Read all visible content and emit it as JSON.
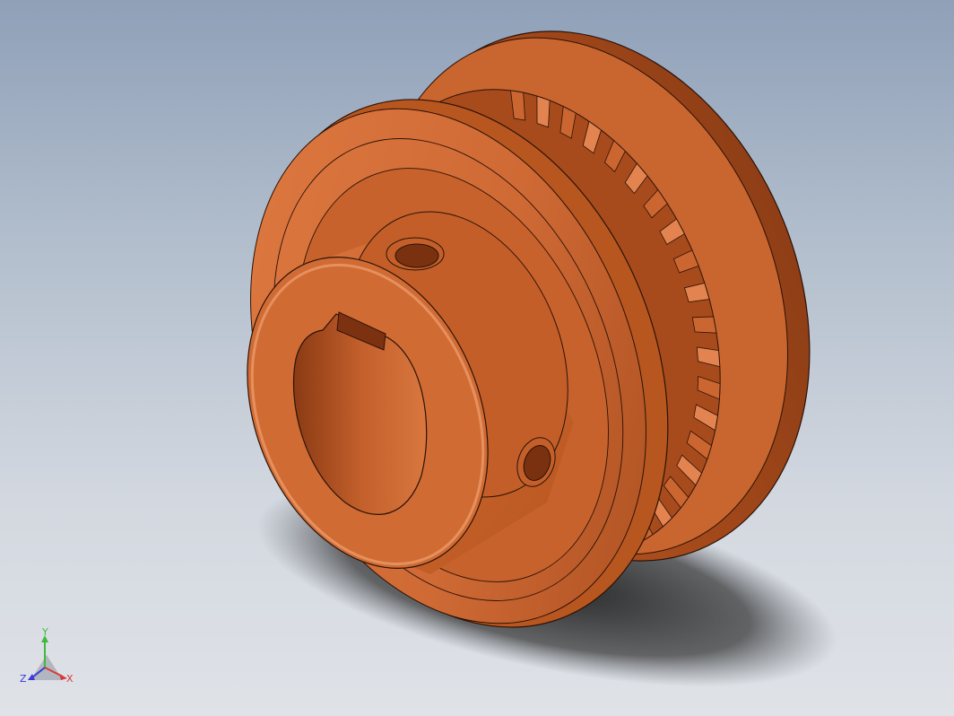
{
  "viewport": {
    "background_top": "#8fa0b8",
    "background_bottom": "#dfe2e7"
  },
  "model": {
    "name_icon": "timing-pulley-model",
    "color": "#cf6a35",
    "shade_color": "#9a4418",
    "highlight_color": "#ec9466",
    "shadow_color": "#2b2b2b"
  },
  "triad": {
    "x_label": "X",
    "y_label": "Y",
    "z_label": "Z",
    "x_color": "#d83a3a",
    "y_color": "#3dbb3d",
    "z_color": "#3a3ad8"
  }
}
